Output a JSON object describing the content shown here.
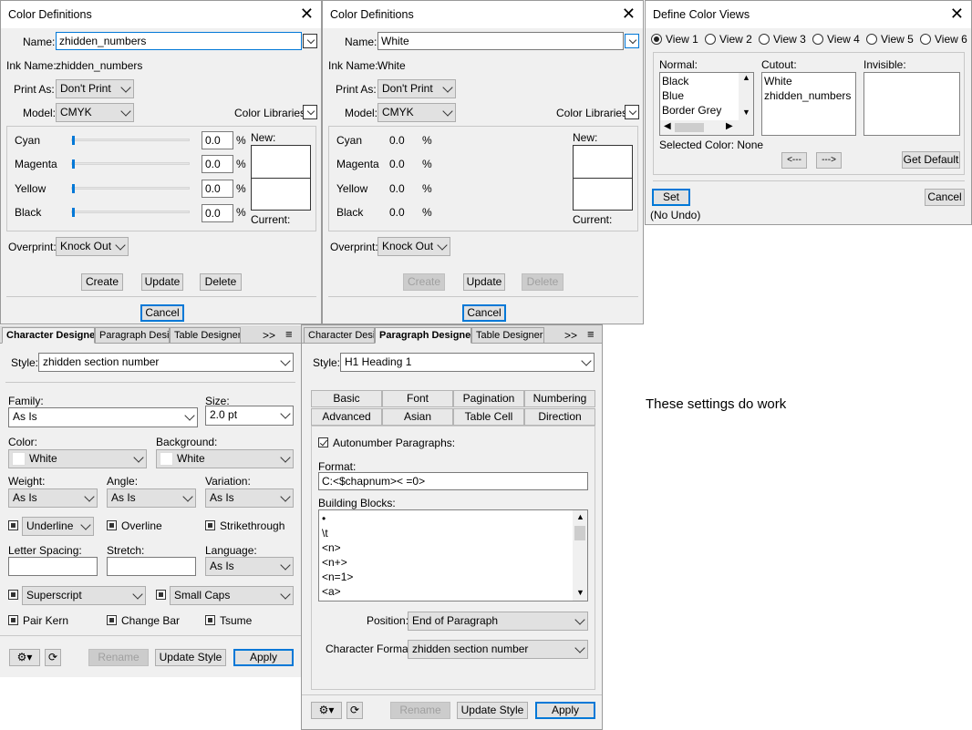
{
  "cd1": {
    "title": "Color Definitions",
    "name_label": "Name:",
    "name_value": "zhidden_numbers",
    "ink_label": "Ink Name:",
    "ink_value": "zhidden_numbers",
    "print_as_label": "Print As:",
    "print_as_value": "Don't Print",
    "model_label": "Model:",
    "model_value": "CMYK",
    "libraries_label": "Color Libraries:",
    "channels": [
      {
        "label": "Cyan",
        "value": "0.0",
        "unit": "%"
      },
      {
        "label": "Magenta",
        "value": "0.0",
        "unit": "%"
      },
      {
        "label": "Yellow",
        "value": "0.0",
        "unit": "%"
      },
      {
        "label": "Black",
        "value": "0.0",
        "unit": "%"
      }
    ],
    "new_label": "New:",
    "current_label": "Current:",
    "overprint_label": "Overprint:",
    "overprint_value": "Knock Out",
    "create_label": "Create",
    "update_label": "Update",
    "delete_label": "Delete",
    "cancel_label": "Cancel"
  },
  "cd2": {
    "title": "Color Definitions",
    "name_label": "Name:",
    "name_value": "White",
    "ink_label": "Ink Name:",
    "ink_value": "White",
    "print_as_label": "Print As:",
    "print_as_value": "Don't Print",
    "model_label": "Model:",
    "model_value": "CMYK",
    "libraries_label": "Color Libraries:",
    "channels": [
      {
        "label": "Cyan",
        "value": "0.0",
        "unit": "%"
      },
      {
        "label": "Magenta",
        "value": "0.0",
        "unit": "%"
      },
      {
        "label": "Yellow",
        "value": "0.0",
        "unit": "%"
      },
      {
        "label": "Black",
        "value": "0.0",
        "unit": "%"
      }
    ],
    "new_label": "New:",
    "current_label": "Current:",
    "overprint_label": "Overprint:",
    "overprint_value": "Knock Out",
    "create_label": "Create",
    "update_label": "Update",
    "delete_label": "Delete",
    "cancel_label": "Cancel"
  },
  "dcv": {
    "title": "Define Color Views",
    "views": [
      "View 1",
      "View 2",
      "View 3",
      "View 4",
      "View 5",
      "View 6"
    ],
    "normal_label": "Normal:",
    "normal_items": [
      "Black",
      "Blue",
      "Border Grey"
    ],
    "cutout_label": "Cutout:",
    "cutout_items": [
      "White",
      "zhidden_numbers"
    ],
    "invisible_label": "Invisible:",
    "selected_text": "Selected Color: None",
    "left_btn": "<---",
    "right_btn": "--->",
    "default_btn": "Get Default",
    "set_btn": "Set",
    "no_undo": "(No Undo)",
    "cancel_btn": "Cancel"
  },
  "chd": {
    "tabs": [
      "Character Designer",
      "Paragraph Designer",
      "Table Designer"
    ],
    "more": ">>",
    "style_label": "Style:",
    "style_value": "zhidden section number",
    "family_label": "Family:",
    "family_value": "As Is",
    "size_label": "Size:",
    "size_value": "2.0 pt",
    "color_label": "Color:",
    "color_value": "White",
    "background_label": "Background:",
    "background_value": "White",
    "weight_label": "Weight:",
    "weight_value": "As Is",
    "angle_label": "Angle:",
    "angle_value": "As Is",
    "variation_label": "Variation:",
    "variation_value": "As Is",
    "underline_value": "Underline",
    "overline_label": "Overline",
    "strike_label": "Strikethrough",
    "letter_label": "Letter Spacing:",
    "stretch_label": "Stretch:",
    "language_label": "Language:",
    "language_value": "As Is",
    "superscript_value": "Superscript",
    "smallcaps_value": "Small Caps",
    "pairkern_label": "Pair Kern",
    "changebar_label": "Change Bar",
    "tsume_label": "Tsume",
    "rename_btn": "Rename",
    "update_btn": "Update Style",
    "apply_btn": "Apply"
  },
  "pd": {
    "tabs": [
      "Character Desig",
      "Paragraph Designer",
      "Table Designer"
    ],
    "more": ">>",
    "style_label": "Style:",
    "style_value": "H1 Heading 1",
    "subtabs_row1": [
      "Basic",
      "Font",
      "Pagination",
      "Numbering"
    ],
    "subtabs_row2": [
      "Advanced",
      "Asian",
      "Table Cell",
      "Direction"
    ],
    "autonumber_label": "Autonumber Paragraphs:",
    "format_label": "Format:",
    "format_value": "C:<$chapnum>< =0>",
    "blocks_label": "Building Blocks:",
    "blocks": [
      "•",
      "\\t",
      "<n>",
      "<n+>",
      "<n=1>",
      "<a>"
    ],
    "position_label": "Position:",
    "position_value": "End of Paragraph",
    "charformat_label": "Character Format:",
    "charformat_value": "zhidden section number",
    "rename_btn": "Rename",
    "update_btn": "Update Style",
    "apply_btn": "Apply"
  },
  "note": "These settings do work"
}
